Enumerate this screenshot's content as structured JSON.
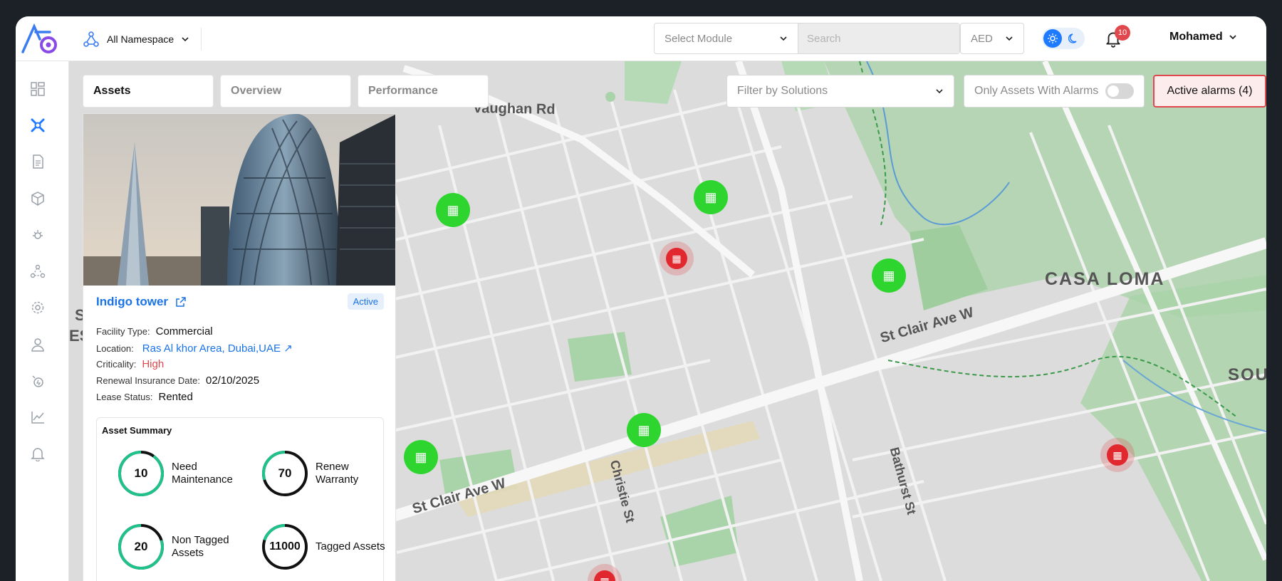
{
  "header": {
    "namespace_label": "All Namespace",
    "module_placeholder": "Select Module",
    "search_placeholder": "Search",
    "currency": "AED",
    "notification_count": "10",
    "user_name": "Mohamed"
  },
  "sidebar": {
    "items": [
      {
        "name": "dashboard-icon",
        "active": false
      },
      {
        "name": "assets-icon",
        "active": true
      },
      {
        "name": "documents-icon",
        "active": false
      },
      {
        "name": "inventory-icon",
        "active": false
      },
      {
        "name": "sensors-icon",
        "active": false
      },
      {
        "name": "hierarchy-icon",
        "active": false
      },
      {
        "name": "settings-icon",
        "active": false
      },
      {
        "name": "user-icon",
        "active": false
      },
      {
        "name": "energy-icon",
        "active": false
      },
      {
        "name": "analytics-icon",
        "active": false
      },
      {
        "name": "alerts-icon",
        "active": false
      }
    ]
  },
  "tabs": [
    {
      "label": "Assets",
      "active": true
    },
    {
      "label": "Overview",
      "active": false
    },
    {
      "label": "Performance",
      "active": false
    }
  ],
  "filters": {
    "solutions_placeholder": "Filter by Solutions",
    "only_alarms_label": "Only Assets With Alarms",
    "only_alarms_enabled": false,
    "active_alarms_label": "Active alarms (4)"
  },
  "map": {
    "labels": [
      "Vaughan Rd",
      "CASA LOMA",
      "St Clair Ave W",
      "St Clair Ave W",
      "Christie St",
      "Bathurst St",
      "SOUT",
      "S",
      "ES"
    ],
    "markers": [
      {
        "status": "ok"
      },
      {
        "status": "ok"
      },
      {
        "status": "alarm"
      },
      {
        "status": "ok"
      },
      {
        "status": "ok"
      },
      {
        "status": "ok"
      },
      {
        "status": "alarm"
      },
      {
        "status": "alarm"
      }
    ]
  },
  "asset": {
    "name": "Indigo tower",
    "status": "Active",
    "fields": [
      {
        "key": "Facility Type:",
        "value": "Commercial"
      },
      {
        "key": "Location:",
        "value": "Ras Al khor Area, Dubai,UAE ↗"
      },
      {
        "key": "Criticality:",
        "value": "High"
      },
      {
        "key": "Renewal Insurance Date:",
        "value": "02/10/2025"
      },
      {
        "key": "Lease Status:",
        "value": "Rented"
      }
    ],
    "summary_title": "Asset Summary",
    "summary": [
      {
        "value": "10",
        "label": "Need Maintenance",
        "fraction": 0.1
      },
      {
        "value": "70",
        "label": "Renew Warranty",
        "fraction": 0.7
      },
      {
        "value": "20",
        "label": "Non Tagged Assets",
        "fraction": 0.2
      },
      {
        "value": "11000",
        "label": "Tagged Assets",
        "fraction": 0.8
      }
    ]
  },
  "colors": {
    "accent": "#1e7bff",
    "ok_marker": "#2ed52e",
    "alarm_marker": "#e0282e",
    "ring": "#1fc28b"
  }
}
